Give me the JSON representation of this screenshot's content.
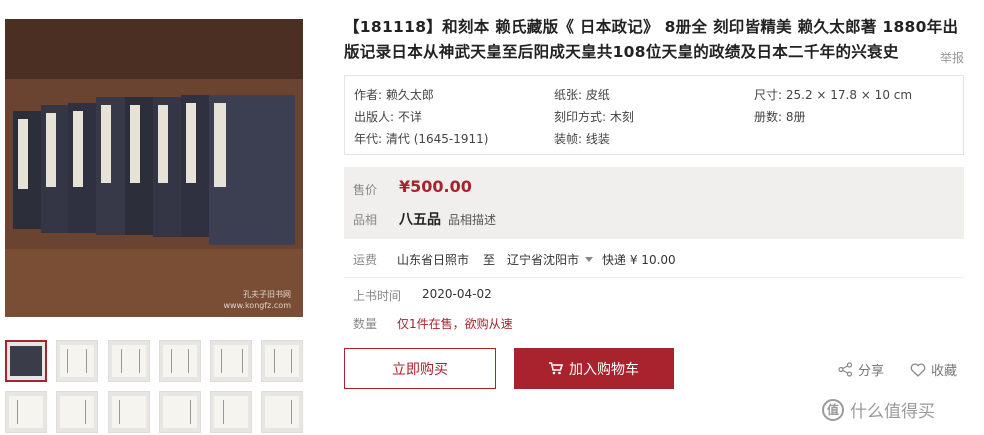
{
  "product": {
    "title": "【181118】和刻本 赖氏藏版《 日本政记》 8册全 刻印皆精美 赖久太郎著 1880年出版记录日本从神武天皇至后阳成天皇共108位天皇的政绩及日本二千年的兴衰史",
    "report_label": "举报",
    "watermark_line1": "孔夫子旧书网",
    "watermark_line2": "www.kongfz.com"
  },
  "attributes": [
    [
      {
        "label": "作者:",
        "value": "赖久太郎"
      },
      {
        "label": "纸张:",
        "value": "皮纸"
      },
      {
        "label": "尺寸:",
        "value": "25.2 × 17.8 × 10 cm"
      }
    ],
    [
      {
        "label": "出版人:",
        "value": "不详"
      },
      {
        "label": "刻印方式:",
        "value": "木刻"
      },
      {
        "label": "册数:",
        "value": "8册"
      }
    ],
    [
      {
        "label": "年代:",
        "value": "清代 (1645-1911)"
      },
      {
        "label": "装帧:",
        "value": "线装"
      },
      {
        "label": "",
        "value": ""
      }
    ]
  ],
  "price": {
    "label": "售价",
    "value": "¥500.00",
    "grade_label": "品相",
    "grade": "八五品",
    "grade_desc": "品相描述"
  },
  "shipping": {
    "label": "运费",
    "from": "山东省日照市",
    "to_word": "至",
    "dest": "辽宁省沈阳市",
    "method": "快递 ¥ 10.00"
  },
  "listing": {
    "date_label": "上书时间",
    "date": "2020-04-02",
    "qty_label": "数量",
    "qty": "仅1件在售，欲购从速"
  },
  "actions": {
    "buy": "立即购买",
    "cart": "加入购物车",
    "share": "分享",
    "favorite": "收藏"
  },
  "brand": {
    "logo_text": "值",
    "name": "什么值得买"
  },
  "colors": {
    "accent": "#a8232d",
    "price_bg": "#f0efed"
  }
}
